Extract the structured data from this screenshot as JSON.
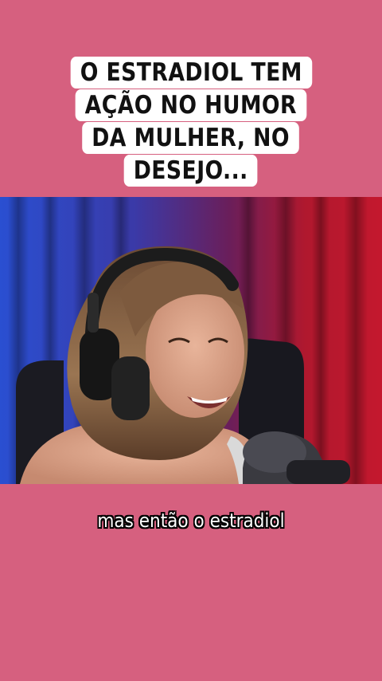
{
  "headline": {
    "lines": [
      "O ESTRADIOL TEM",
      "AÇÃO NO HUMOR",
      "DA MULHER, NO",
      "DESEJO..."
    ],
    "box_color": "#ffffff",
    "text_color": "#111111"
  },
  "subtitle": {
    "text": "mas então o estradiol"
  },
  "colors": {
    "background": "#d6607f",
    "curtain_left": "#2a4fd1",
    "curtain_right": "#c4182e"
  },
  "icons": {
    "headphones": "headphones-icon",
    "microphone": "microphone-icon"
  }
}
